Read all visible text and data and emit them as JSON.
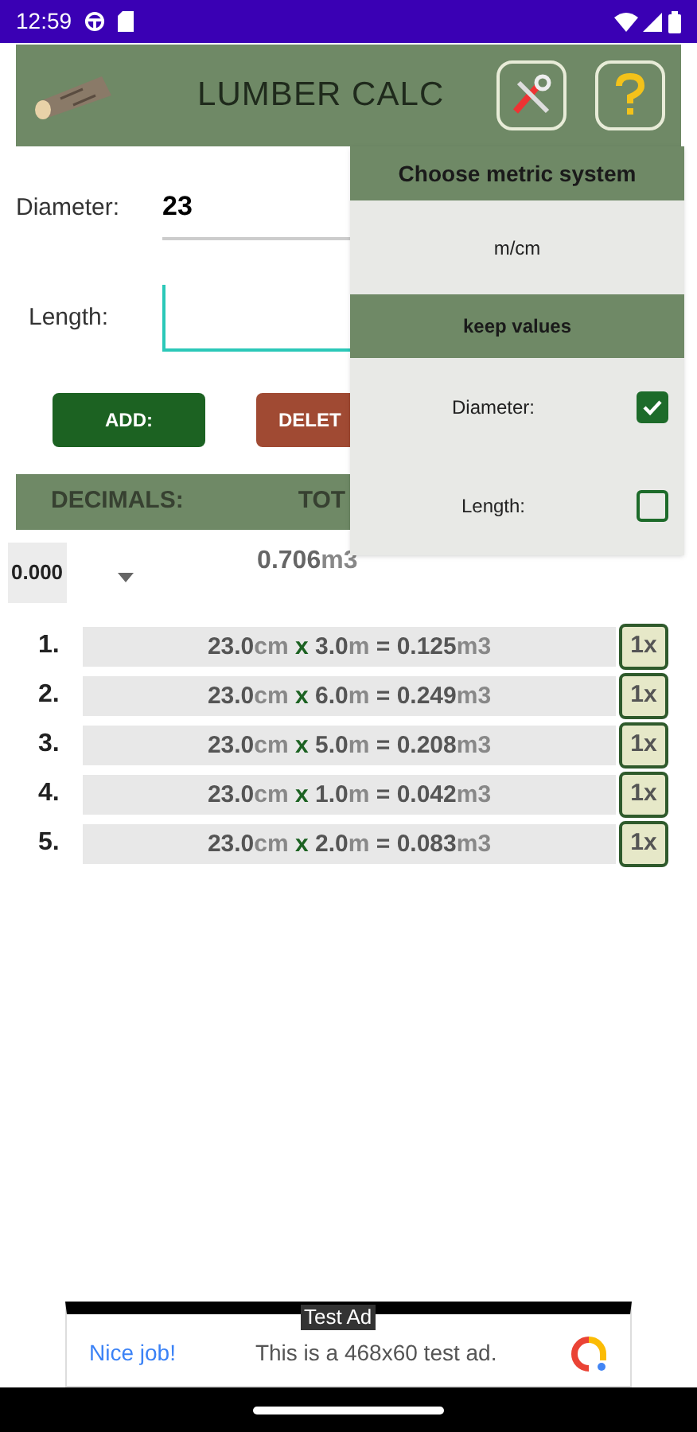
{
  "status_bar": {
    "time": "12:59"
  },
  "header": {
    "title": "LUMBER CALC"
  },
  "form": {
    "diameter": {
      "label": "Diameter:",
      "value": "23"
    },
    "length": {
      "label": "Length:",
      "focused": true
    }
  },
  "buttons": {
    "add": "ADD:",
    "delete": "DELET"
  },
  "summary": {
    "decimals_label": "DECIMALS:",
    "total_label": "TOT",
    "decimals_value": "0.000",
    "total": "0.706",
    "total_unit": "m3"
  },
  "settings_menu": {
    "title": "Choose metric system",
    "unit_option": "m/cm",
    "keep_title": "keep values",
    "keep": [
      {
        "label": "Diameter:",
        "checked": true
      },
      {
        "label": "Length:",
        "checked": false
      }
    ]
  },
  "entries": [
    {
      "number": "1.",
      "diameter": "23.0",
      "diameter_unit": "cm",
      "times": "x",
      "length": "3.0",
      "length_unit": "m",
      "equals": "=",
      "volume": "0.125",
      "volume_unit": "m3",
      "count": "1x"
    },
    {
      "number": "2.",
      "diameter": "23.0",
      "diameter_unit": "cm",
      "times": "x",
      "length": "6.0",
      "length_unit": "m",
      "equals": "=",
      "volume": "0.249",
      "volume_unit": "m3",
      "count": "1x"
    },
    {
      "number": "3.",
      "diameter": "23.0",
      "diameter_unit": "cm",
      "times": "x",
      "length": "5.0",
      "length_unit": "m",
      "equals": "=",
      "volume": "0.208",
      "volume_unit": "m3",
      "count": "1x"
    },
    {
      "number": "4.",
      "diameter": "23.0",
      "diameter_unit": "cm",
      "times": "x",
      "length": "1.0",
      "length_unit": "m",
      "equals": "=",
      "volume": "0.042",
      "volume_unit": "m3",
      "count": "1x"
    },
    {
      "number": "5.",
      "diameter": "23.0",
      "diameter_unit": "cm",
      "times": "x",
      "length": "2.0",
      "length_unit": "m",
      "equals": "=",
      "volume": "0.083",
      "volume_unit": "m3",
      "count": "1x"
    }
  ],
  "ad": {
    "badge": "Test Ad",
    "headline": "Nice job!",
    "text": "This is a 468x60 test ad."
  }
}
